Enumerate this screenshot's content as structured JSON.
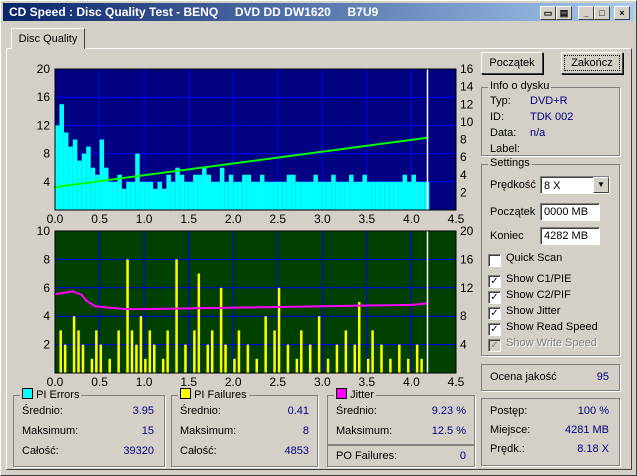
{
  "window": {
    "title": "CD Speed : Disc Quality Test - BENQ     DVD DD DW1620     B7U9",
    "controls": [
      "minimize",
      "restore",
      "close"
    ]
  },
  "tabs": [
    {
      "label": "Disc Quality",
      "active": true
    }
  ],
  "buttons": {
    "start": "Początek",
    "stop": "Zakończ"
  },
  "disc_info": {
    "title": "Info o dysku",
    "type_label": "Typ:",
    "type_value": "DVD+R",
    "id_label": "ID:",
    "id_value": "TDK 002",
    "date_label": "Data:",
    "date_value": "n/a",
    "label_label": "Label:",
    "label_value": ""
  },
  "settings": {
    "title": "Settings",
    "speed_label": "Prędkość",
    "speed_value": "8 X",
    "start_label": "Początek",
    "start_value": "0000 MB",
    "end_label": "Koniec",
    "end_value": "4282 MB",
    "checks": [
      {
        "label": "Quick Scan",
        "checked": false,
        "enabled": true
      },
      {
        "label": "Show C1/PIE",
        "checked": true,
        "enabled": true
      },
      {
        "label": "Show C2/PIF",
        "checked": true,
        "enabled": true
      },
      {
        "label": "Show Jitter",
        "checked": true,
        "enabled": true
      },
      {
        "label": "Show Read Speed",
        "checked": true,
        "enabled": true
      },
      {
        "label": "Show Write Speed",
        "checked": true,
        "enabled": false
      }
    ]
  },
  "quality": {
    "label": "Ocena jakość",
    "value": "95"
  },
  "progress": {
    "progress_label": "Postęp:",
    "progress_value": "100 %",
    "position_label": "Miejsce:",
    "position_value": "4281 MB",
    "speed_label": "Prędk.:",
    "speed_value": "8.18 X"
  },
  "stats": {
    "pi_errors": {
      "title": "PI Errors",
      "color": "#00ffff",
      "avg_label": "Średnio:",
      "avg": "3.95",
      "max_label": "Maksimum:",
      "max": "15",
      "total_label": "Całość:",
      "total": "39320"
    },
    "pi_failures": {
      "title": "PI Failures",
      "color": "#ffff00",
      "avg_label": "Średnio:",
      "avg": "0.41",
      "max_label": "Maksimum:",
      "max": "8",
      "total_label": "Całość:",
      "total": "4853"
    },
    "jitter": {
      "title": "Jitter",
      "color": "#ff00ff",
      "avg_label": "Średnio:",
      "avg": "9.23 %",
      "max_label": "Maksimum:",
      "max": "12.5 %"
    },
    "po_failures": {
      "label": "PO Failures:",
      "value": "0"
    }
  },
  "chart_data": [
    {
      "type": "area",
      "background": "#000080",
      "x_ticks": [
        "0.0",
        "0.5",
        "1.0",
        "1.5",
        "2.0",
        "2.5",
        "3.0",
        "3.5",
        "4.0",
        "4.5"
      ],
      "y_left_ticks": [
        "4",
        "8",
        "12",
        "16",
        "20"
      ],
      "y_right_ticks": [
        "2",
        "4",
        "6",
        "8",
        "10",
        "12",
        "14",
        "16"
      ],
      "xlim": [
        0,
        4.5
      ],
      "ylim_left": [
        0,
        20
      ],
      "ylim_right": [
        0,
        16
      ],
      "disc_end": 4.18,
      "series": [
        {
          "values_desc": "PI errors per block",
          "color": "#00ffff",
          "x": [
            0,
            0.05,
            0.1,
            0.15,
            0.2,
            0.25,
            0.3,
            0.35,
            0.4,
            0.45,
            0.5,
            0.55,
            0.6,
            0.65,
            0.7,
            0.75,
            0.8,
            0.85,
            0.9,
            0.95,
            1.0,
            1.05,
            1.1,
            1.15,
            1.2,
            1.25,
            1.3,
            1.35,
            1.4,
            1.45,
            1.5,
            1.55,
            1.6,
            1.65,
            1.7,
            1.75,
            1.8,
            1.85,
            1.9,
            1.95,
            2.0,
            2.05,
            2.1,
            2.15,
            2.2,
            2.25,
            2.3,
            2.35,
            2.4,
            2.45,
            2.5,
            2.55,
            2.6,
            2.65,
            2.7,
            2.75,
            2.8,
            2.85,
            2.9,
            2.95,
            3.0,
            3.05,
            3.1,
            3.15,
            3.2,
            3.25,
            3.3,
            3.35,
            3.4,
            3.45,
            3.5,
            3.55,
            3.6,
            3.65,
            3.7,
            3.75,
            3.8,
            3.85,
            3.9,
            3.95,
            4.0,
            4.05,
            4.1,
            4.15
          ],
          "y": [
            12,
            15,
            11,
            9,
            10,
            7,
            8,
            9,
            6,
            5,
            10,
            6,
            4,
            4,
            5,
            3,
            4,
            4,
            8,
            4,
            4,
            4,
            3,
            4,
            3,
            5,
            4,
            6,
            5,
            4,
            4,
            5,
            5,
            6,
            5,
            4,
            4,
            6,
            4,
            5,
            4,
            4,
            5,
            5,
            4,
            4,
            5,
            4,
            4,
            4,
            4,
            4,
            5,
            5,
            4,
            4,
            4,
            4,
            5,
            4,
            4,
            4,
            5,
            4,
            4,
            4,
            5,
            4,
            4,
            5,
            4,
            4,
            4,
            4,
            4,
            4,
            4,
            4,
            5,
            4,
            5,
            4,
            4,
            4
          ]
        },
        {
          "name": "Read speed",
          "color": "#00ff00",
          "axis": "right",
          "x": [
            0.0,
            4.18
          ],
          "y": [
            2.6,
            8.2
          ]
        }
      ]
    },
    {
      "type": "area",
      "background": "#004000",
      "x_ticks": [
        "0.0",
        "0.5",
        "1.0",
        "1.5",
        "2.0",
        "2.5",
        "3.0",
        "3.5",
        "4.0",
        "4.5"
      ],
      "y_left_ticks": [
        "2",
        "4",
        "6",
        "8",
        "10"
      ],
      "y_right_ticks": [
        "4",
        "8",
        "12",
        "16",
        "20"
      ],
      "xlim": [
        0,
        4.5
      ],
      "ylim_left": [
        0,
        10
      ],
      "ylim_right": [
        0,
        20
      ],
      "disc_end": 4.18,
      "series": [
        {
          "values_desc": "PI failures per block",
          "color": "#ffff00",
          "x": [
            0.05,
            0.1,
            0.2,
            0.25,
            0.3,
            0.4,
            0.45,
            0.5,
            0.6,
            0.7,
            0.8,
            0.85,
            0.9,
            0.95,
            1.0,
            1.05,
            1.1,
            1.2,
            1.25,
            1.35,
            1.45,
            1.55,
            1.6,
            1.7,
            1.75,
            1.85,
            1.9,
            2.0,
            2.05,
            2.15,
            2.25,
            2.35,
            2.45,
            2.5,
            2.6,
            2.7,
            2.75,
            2.85,
            2.95,
            3.05,
            3.15,
            3.25,
            3.35,
            3.4,
            3.5,
            3.55,
            3.65,
            3.75,
            3.85,
            3.95,
            4.05,
            4.1
          ],
          "y": [
            3,
            2,
            4,
            3,
            2,
            1,
            3,
            2,
            1,
            3,
            8,
            3,
            2,
            4,
            1,
            3,
            2,
            1,
            3,
            8,
            2,
            3,
            7,
            2,
            3,
            6,
            2,
            1,
            3,
            2,
            1,
            4,
            3,
            6,
            2,
            1,
            3,
            2,
            4,
            1,
            2,
            3,
            2,
            5,
            1,
            3,
            2,
            1,
            2,
            1,
            2,
            1
          ]
        },
        {
          "name": "Jitter",
          "color": "#ff00ff",
          "axis": "right",
          "x": [
            0.0,
            0.1,
            0.2,
            0.3,
            0.35,
            0.45,
            0.6,
            0.8,
            1.0,
            1.5,
            2.0,
            2.5,
            3.0,
            3.5,
            4.0,
            4.18
          ],
          "y": [
            11.1,
            11.3,
            11.5,
            11.0,
            10.2,
            9.4,
            9.2,
            9.0,
            9.0,
            9.1,
            9.2,
            9.3,
            9.4,
            9.5,
            9.6,
            9.8
          ]
        }
      ]
    }
  ]
}
